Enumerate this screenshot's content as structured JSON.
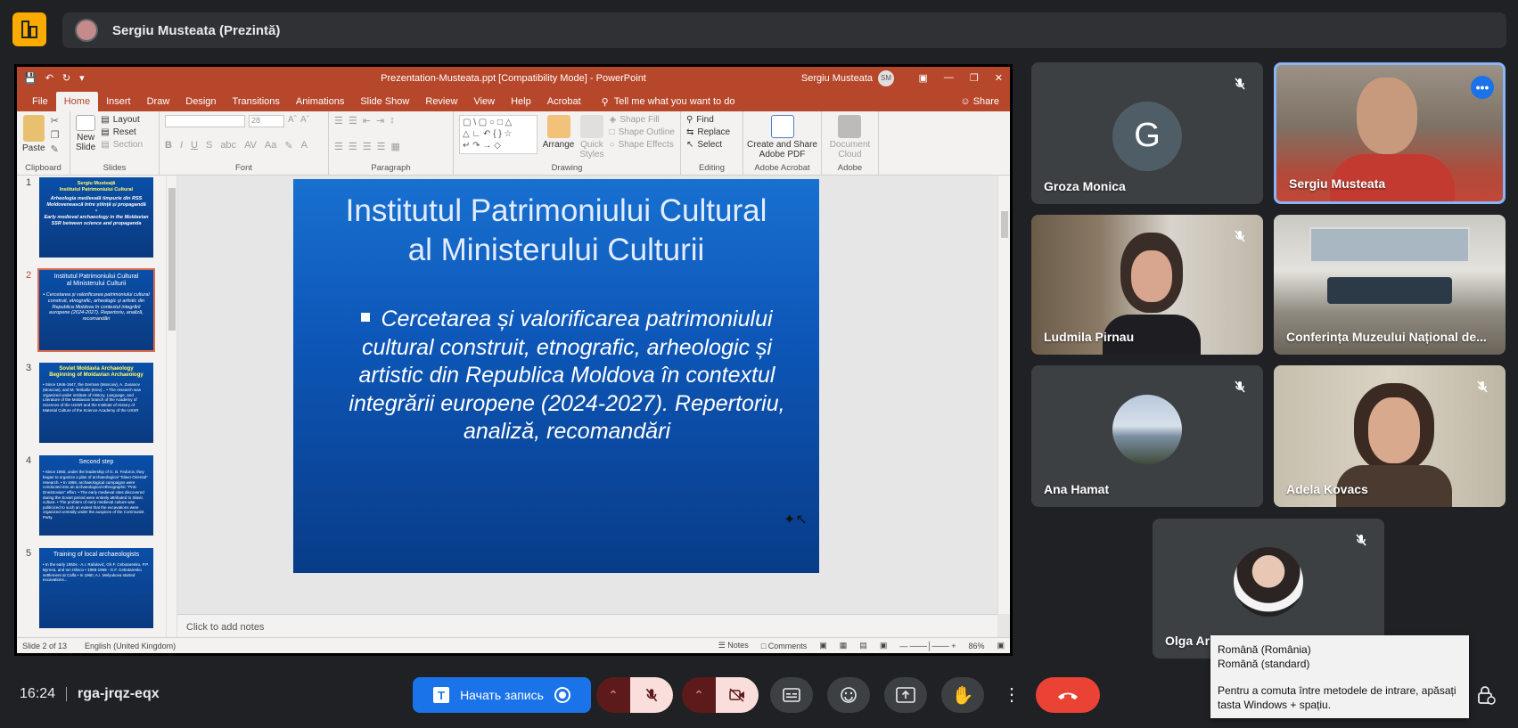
{
  "presenter": {
    "name": "Sergiu Musteata (Prezintă)"
  },
  "ppt": {
    "document_title": "Prezentation-Musteata.ppt [Compatibility Mode]  -  PowerPoint",
    "user_name": "Sergiu Musteata",
    "user_initials": "SM",
    "tabs": [
      "File",
      "Home",
      "Insert",
      "Draw",
      "Design",
      "Transitions",
      "Animations",
      "Slide Show",
      "Review",
      "View",
      "Help",
      "Acrobat"
    ],
    "tell_me": "Tell me what you want to do",
    "share": "Share",
    "ribbon": {
      "clipboard": {
        "label": "Clipboard",
        "paste": "Paste"
      },
      "slides": {
        "label": "Slides",
        "new_slide": "New\nSlide",
        "layout": "Layout",
        "reset": "Reset",
        "section": "Section"
      },
      "font": {
        "label": "Font",
        "size": "28"
      },
      "paragraph": {
        "label": "Paragraph"
      },
      "drawing": {
        "label": "Drawing",
        "arrange": "Arrange",
        "quick_styles": "Quick\nStyles",
        "shape_fill": "Shape Fill",
        "shape_outline": "Shape Outline",
        "shape_effects": "Shape Effects"
      },
      "editing": {
        "label": "Editing",
        "find": "Find",
        "replace": "Replace",
        "select": "Select"
      },
      "acrobat": {
        "label": "Adobe Acrobat",
        "create": "Create and Share\nAdobe PDF"
      },
      "adobe": {
        "label": "Adobe",
        "document_cloud": "Document\nCloud"
      }
    },
    "thumbnails": [
      {
        "num": "1",
        "title": "Sergiu Musteaţă\nInstitutul Patrimoniului Cultural",
        "body": "Arheologia medievală timpurie din RSS Moldovenească între știință și propagandă\n•\nEarly medieval archaeology in the Moldavian SSR between science and propaganda"
      },
      {
        "num": "2",
        "title": "Institutul Patrimoniului Cultural\nal Ministerului Culturii",
        "body": "▪ Cercetarea și valorificarea patrimoniului cultural construit, etnografic, arheologic și artistic din Republica Moldova în contextul integrării europene (2024-2027). Repertoriu, analiză, recomandări"
      },
      {
        "num": "3",
        "title": "Soviet Moldavia Archaeology\nBeginning of Moldavian Archaeology",
        "body": "• Since 1946-1947, the German (Moscow), A. Zusanov (Moscow), and M. Terikallo (Kiev)... • The research was organized under institute of History, Language, and Literature of the Moldavian branch of the Academy of Sciences of the USSR and the Institute of History of Material Culture of the Science Academy of the USSR"
      },
      {
        "num": "4",
        "title": "Second step",
        "body": "• Since 1950, under the leadership of G. B. Fedorov, they began to organize a plan of archaeological \"Slavo-Oriental\" research. • In 1958, archaeological campaigns were conducted into an archaeological-ethnographic \"Prut-Dnestrovian\" effort. • The early medieval sites discovered during the Soviet period were entirely attributed to Slavic culture. • The problem of early medieval culture was politicized to such an extent that the excavations were organized centrally under the auspices of the Communist Party."
      },
      {
        "num": "5",
        "title": "Training of local archaeologists",
        "body": "• In the early 1950s - A.I. Rafalović, Gh.F. Cebotarenko, P.P. Byrnea, and Ion Hâncu • 1959-1968 - G.F. Cebotarenko settlement at Calfa • In 1960, A.I. Melyukova started excavations..."
      }
    ],
    "slide": {
      "title_line1": "Institutul Patrimoniului Cultural",
      "title_line2": "al Ministerului Culturii",
      "bullet": "Cercetarea și valorificarea patrimoniului cultural construit, etnografic, arheologic și artistic din Republica Moldova în contextul integrării europene (2024-2027). Repertoriu, analiză, recomandări"
    },
    "notes_placeholder": "Click to add notes",
    "status": {
      "slide_of": "Slide 2 of 13",
      "language": "English (United Kingdom)",
      "notes": "Notes",
      "comments": "Comments",
      "zoom": "86%"
    }
  },
  "participants": [
    {
      "name": "Groza Monica",
      "avatar_letter": "G",
      "muted": true
    },
    {
      "name": "Sergiu Musteata",
      "muted": false,
      "active_speaker": true
    },
    {
      "name": "Ludmila Pirnau",
      "muted": true
    },
    {
      "name": "Conferința Muzeului Național de...",
      "muted": false
    },
    {
      "name": "Ana Hamat",
      "muted": true
    },
    {
      "name": "Adela Kovacs",
      "muted": true
    },
    {
      "name": "Olga Ar",
      "muted": true
    }
  ],
  "meeting": {
    "time": "16:24",
    "code": "rga-jrqz-eqx",
    "record_label": "Начать запись"
  },
  "ime_popup": {
    "line1": "Română (România)",
    "line2": "Română (standard)",
    "hint_line1": "Pentru a comuta între metodele de intrare, apăsați",
    "hint_line2": "tasta Windows + spațiu."
  },
  "colors": {
    "meet_bg": "#202124",
    "ppt_accent": "#b7472a",
    "active_speaker_border": "#8ab4f8",
    "hangup": "#ea4335",
    "record": "#1a73e8"
  }
}
